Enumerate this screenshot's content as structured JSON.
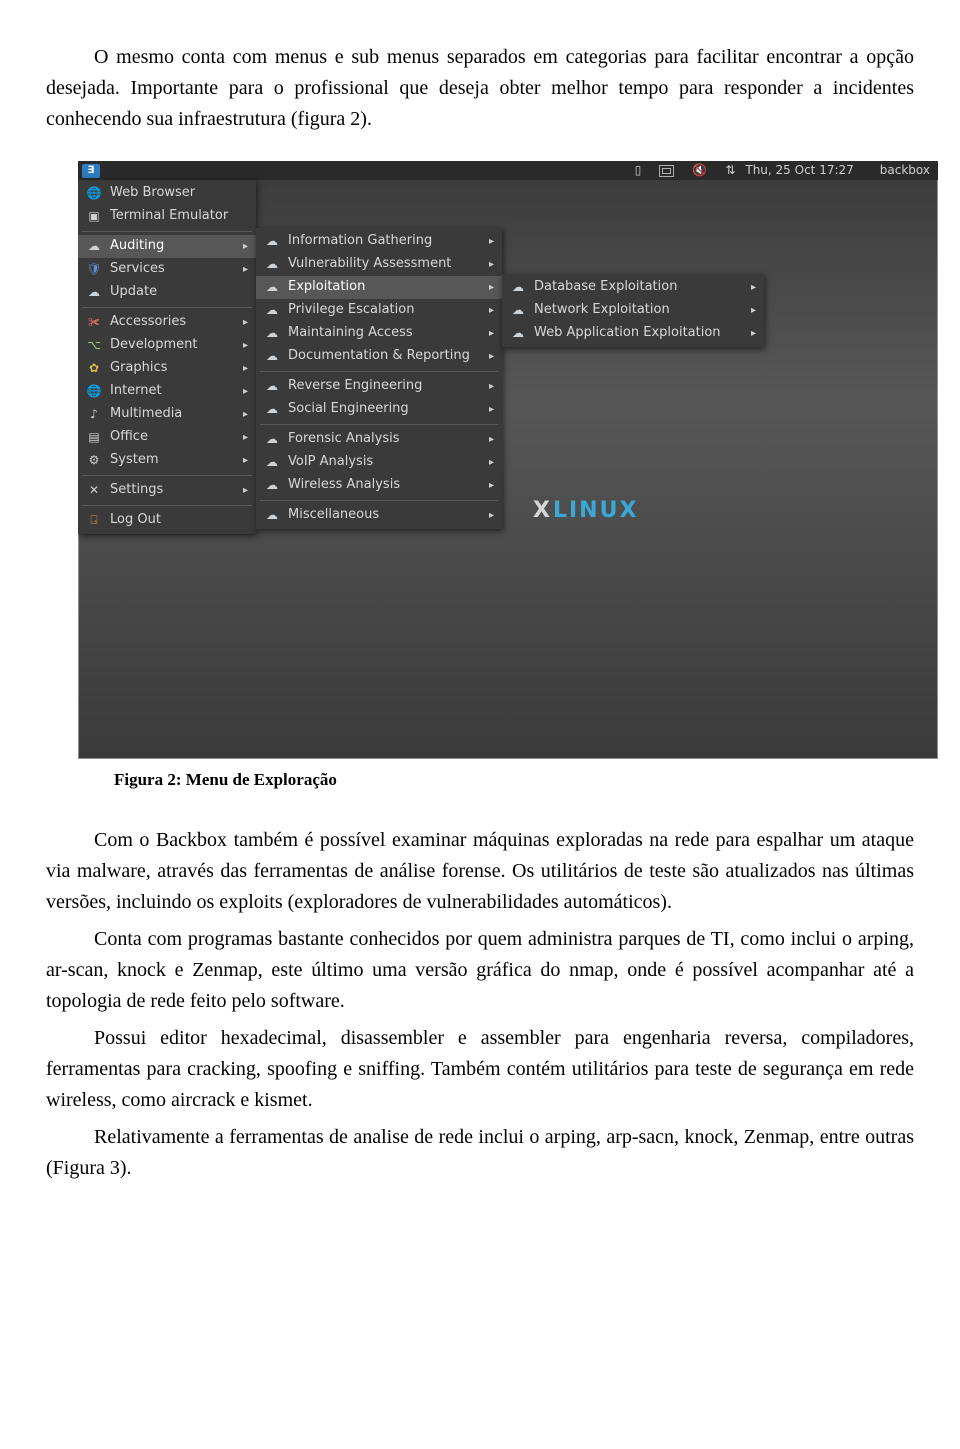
{
  "paragraphs": {
    "p1a": "O mesmo conta com menus e sub menus separados em categorias para facilitar encontrar a opção desejada. Importante para o profissional que deseja obter melhor tempo para responder a incidentes conhecendo sua infraestrutura (figura 2).",
    "caption": "Figura 2: Menu de Exploração",
    "p2": "Com o Backbox também é possível examinar máquinas exploradas na rede para espalhar um ataque via malware, através das ferramentas de análise forense. Os utilitários de teste são atualizados nas últimas versões, incluindo os exploits (exploradores de vulnerabilidades automáticos).",
    "p3": "Conta com programas bastante conhecidos por quem administra parques de TI, como inclui o arping, ar-scan, knock e Zenmap, este último uma versão gráfica do nmap, onde é possível acompanhar até a topologia de rede feito pelo software.",
    "p4": "Possui editor hexadecimal, disassembler e assembler para engenharia reversa, compiladores, ferramentas para cracking, spoofing e sniffing. Também contém utilitários para teste de segurança em rede wireless, como aircrack e kismet.",
    "p5": "Relativamente a ferramentas de analise de rede inclui o arping, arp-sacn, knock, Zenmap, entre outras (Figura 3)."
  },
  "screenshot": {
    "panel": {
      "clock": "Thu, 25 Oct  17:27",
      "user": "backbox"
    },
    "brand_suffix": "LINUX",
    "menu1": [
      {
        "label": "Web Browser",
        "icon": "🌐",
        "cls": "col-globe",
        "sub": false
      },
      {
        "label": "Terminal Emulator",
        "icon": "▣",
        "cls": "col-term",
        "sub": false
      },
      {
        "sep": true
      },
      {
        "label": "Auditing",
        "icon": "☁",
        "cls": "col-cloud",
        "sub": true,
        "hi": true
      },
      {
        "label": "Services",
        "icon": "🛡",
        "cls": "col-shield",
        "sub": true
      },
      {
        "label": "Update",
        "icon": "☁",
        "cls": "col-cloud",
        "sub": false
      },
      {
        "sep": true
      },
      {
        "label": "Accessories",
        "icon": "✀",
        "cls": "col-red",
        "sub": true
      },
      {
        "label": "Development",
        "icon": "⌥",
        "cls": "col-green",
        "sub": true
      },
      {
        "label": "Graphics",
        "icon": "✿",
        "cls": "col-yel",
        "sub": true
      },
      {
        "label": "Internet",
        "icon": "🌐",
        "cls": "col-globe",
        "sub": true
      },
      {
        "label": "Multimedia",
        "icon": "♪",
        "cls": "col-term",
        "sub": true
      },
      {
        "label": "Office",
        "icon": "▤",
        "cls": "col-term",
        "sub": true
      },
      {
        "label": "System",
        "icon": "⚙",
        "cls": "col-term",
        "sub": true
      },
      {
        "sep": true
      },
      {
        "label": "Settings",
        "icon": "✕",
        "cls": "col-term",
        "sub": true
      },
      {
        "sep": true
      },
      {
        "label": "Log Out",
        "icon": "⍈",
        "cls": "col-orange",
        "sub": false
      }
    ],
    "menu2": [
      {
        "label": "Information Gathering",
        "icon": "☁",
        "cls": "col-cloud",
        "sub": true
      },
      {
        "label": "Vulnerability Assessment",
        "icon": "☁",
        "cls": "col-cloud",
        "sub": true
      },
      {
        "label": "Exploitation",
        "icon": "☁",
        "cls": "col-cloud",
        "sub": true,
        "hi": true
      },
      {
        "label": "Privilege Escalation",
        "icon": "☁",
        "cls": "col-cloud",
        "sub": true
      },
      {
        "label": "Maintaining Access",
        "icon": "☁",
        "cls": "col-cloud",
        "sub": true
      },
      {
        "label": "Documentation & Reporting",
        "icon": "☁",
        "cls": "col-cloud",
        "sub": true
      },
      {
        "sep": true
      },
      {
        "label": "Reverse Engineering",
        "icon": "☁",
        "cls": "col-cloud",
        "sub": true
      },
      {
        "label": "Social Engineering",
        "icon": "☁",
        "cls": "col-cloud",
        "sub": true
      },
      {
        "sep": true
      },
      {
        "label": "Forensic Analysis",
        "icon": "☁",
        "cls": "col-cloud",
        "sub": true
      },
      {
        "label": "VoIP Analysis",
        "icon": "☁",
        "cls": "col-cloud",
        "sub": true
      },
      {
        "label": "Wireless Analysis",
        "icon": "☁",
        "cls": "col-cloud",
        "sub": true
      },
      {
        "sep": true
      },
      {
        "label": "Miscellaneous",
        "icon": "☁",
        "cls": "col-cloud",
        "sub": true
      }
    ],
    "menu3": [
      {
        "label": "Database Exploitation",
        "icon": "☁",
        "cls": "col-cloud",
        "sub": true
      },
      {
        "label": "Network Exploitation",
        "icon": "☁",
        "cls": "col-cloud",
        "sub": true
      },
      {
        "label": "Web Application Exploitation",
        "icon": "☁",
        "cls": "col-cloud",
        "sub": true
      }
    ]
  }
}
